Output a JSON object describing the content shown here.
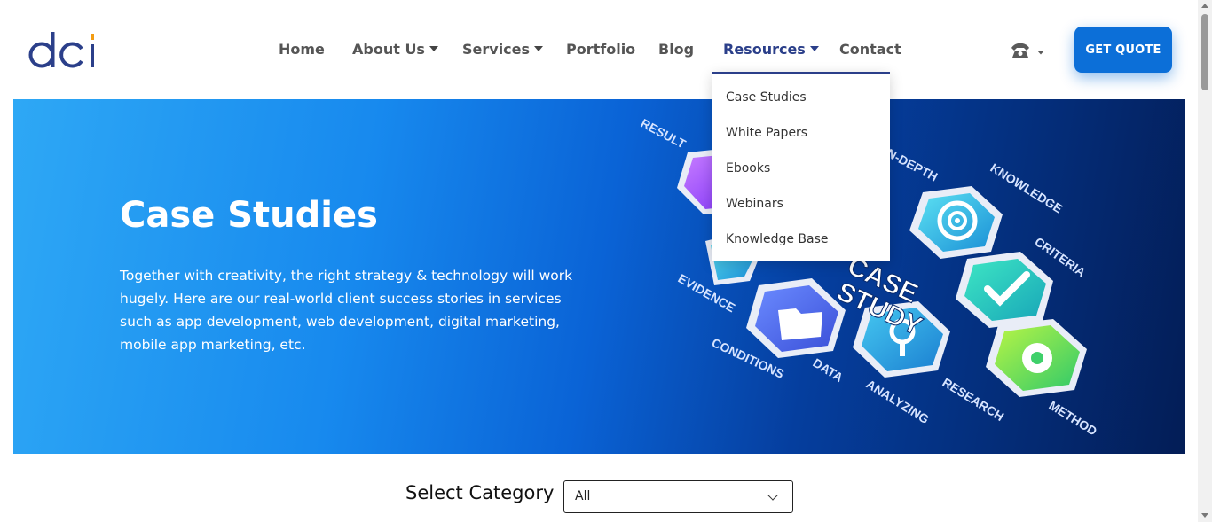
{
  "header": {
    "logo_text": "dci",
    "nav": [
      {
        "label": "Home",
        "has_caret": false
      },
      {
        "label": "About Us",
        "has_caret": true
      },
      {
        "label": "Services",
        "has_caret": true
      },
      {
        "label": "Portfolio",
        "has_caret": false
      },
      {
        "label": "Blog",
        "has_caret": false
      },
      {
        "label": "Resources",
        "has_caret": true,
        "active": true
      },
      {
        "label": "Contact",
        "has_caret": false
      }
    ],
    "phone_icon": "phone-icon",
    "quote_button": "GET QUOTE"
  },
  "resources_menu": {
    "items": [
      "Case Studies",
      "White Papers",
      "Ebooks",
      "Webinars",
      "Knowledge Base"
    ]
  },
  "hero": {
    "title": "Case Studies",
    "description": "Together with creativity, the right strategy & technology will work hugely. Here are our real-world client success stories in services such as app development, web development, digital marketing, mobile app marketing, etc.",
    "art_words": {
      "result": "RESULT",
      "in_depth": "IN-DEPTH",
      "knowledge": "KNOWLEDGE",
      "criteria": "CRITERIA",
      "evidence": "EVIDENCE",
      "conditions": "CONDITIONS",
      "data": "DATA",
      "analyzing": "ANALYZING",
      "research": "RESEARCH",
      "method": "METHOD",
      "case": "CASE",
      "study": "STUDY"
    }
  },
  "category": {
    "label": "Select Category",
    "selected": "All"
  },
  "colors": {
    "brand_blue": "#2b3f8a",
    "accent_orange": "#f39c12",
    "button_blue": "#0c6fd8"
  }
}
